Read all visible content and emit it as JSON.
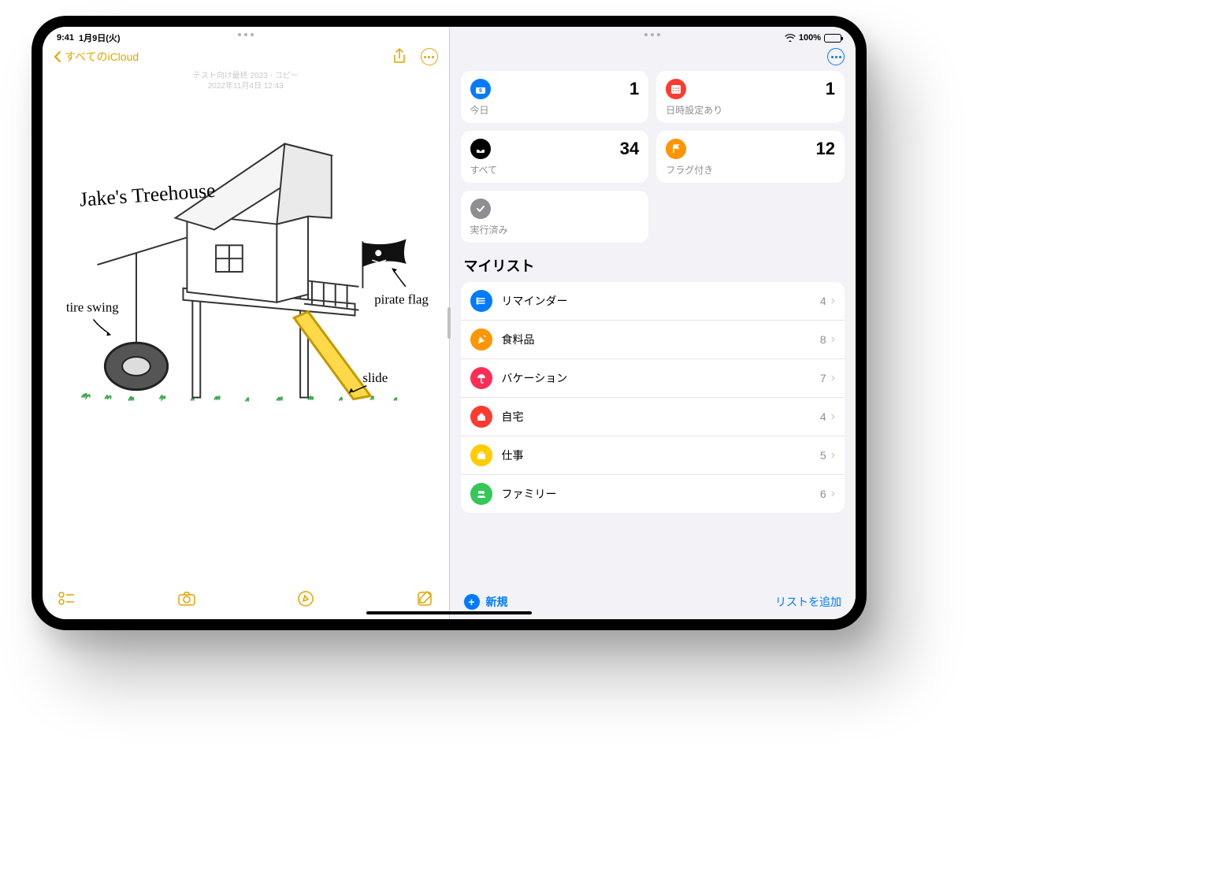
{
  "status": {
    "time": "9:41",
    "date": "1月9日(火)",
    "battery_pct": "100%"
  },
  "notes": {
    "back_label": "すべてのiCloud",
    "meta_line1": "テスト向け最終 2023 - コピー",
    "meta_line2": "2022年11月4日 12:43",
    "drawing": {
      "title": "Jake's Treehouse",
      "label_tire_swing": "tire swing",
      "label_pirate_flag": "pirate flag",
      "label_slide": "slide"
    }
  },
  "reminders": {
    "smart": {
      "today": {
        "label": "今日",
        "count": "1"
      },
      "scheduled": {
        "label": "日時設定あり",
        "count": "1"
      },
      "all": {
        "label": "すべて",
        "count": "34"
      },
      "flagged": {
        "label": "フラグ付き",
        "count": "12"
      },
      "completed": {
        "label": "実行済み",
        "count": ""
      }
    },
    "section_title": "マイリスト",
    "lists": [
      {
        "label": "リマインダー",
        "count": "4",
        "color": "lc-blue",
        "icon": "list"
      },
      {
        "label": "食料品",
        "count": "8",
        "color": "lc-orange",
        "icon": "carrot"
      },
      {
        "label": "バケーション",
        "count": "7",
        "color": "lc-pink",
        "icon": "umbrella"
      },
      {
        "label": "自宅",
        "count": "4",
        "color": "lc-red",
        "icon": "home"
      },
      {
        "label": "仕事",
        "count": "5",
        "color": "lc-yellow",
        "icon": "briefcase"
      },
      {
        "label": "ファミリー",
        "count": "6",
        "color": "lc-green",
        "icon": "people"
      }
    ],
    "new_label": "新規",
    "add_list_label": "リストを追加"
  }
}
